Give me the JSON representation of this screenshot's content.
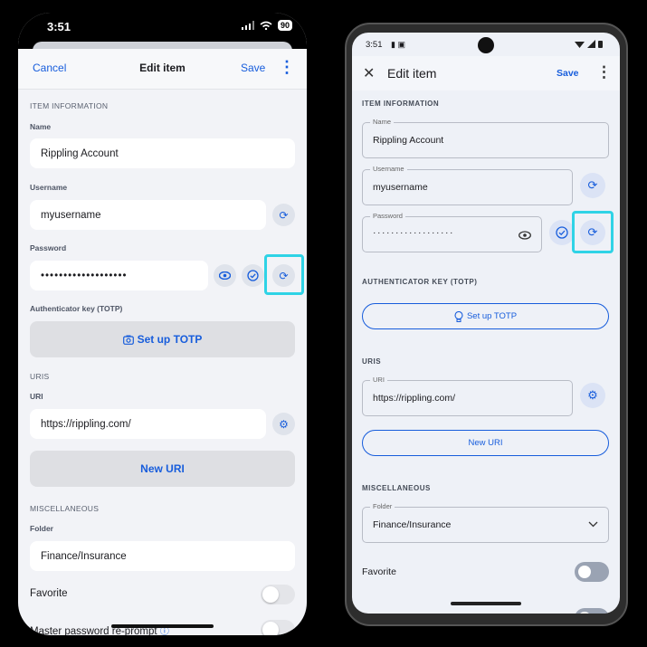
{
  "ios": {
    "status": {
      "time": "3:51",
      "battery": "90"
    },
    "nav": {
      "cancel": "Cancel",
      "title": "Edit item",
      "save": "Save"
    },
    "item_info_header": "ITEM INFORMATION",
    "name_label": "Name",
    "name_value": "Rippling Account",
    "username_label": "Username",
    "username_value": "myusername",
    "password_label": "Password",
    "password_value": "•••••••••••••••••••",
    "totp_label": "Authenticator key (TOTP)",
    "totp_button": "Set up TOTP",
    "uris_header": "URIS",
    "uri_label": "URI",
    "uri_value": "https://rippling.com/",
    "new_uri_button": "New URI",
    "misc_header": "MISCELLANEOUS",
    "folder_label": "Folder",
    "folder_value": "Finance/Insurance",
    "favorite_label": "Favorite",
    "reprompt_label": "Master password re-prompt",
    "accent_color": "#175ddc",
    "highlight_color": "#2fd3e6"
  },
  "android": {
    "status": {
      "time": "3:51"
    },
    "header": {
      "title": "Edit item",
      "save": "Save"
    },
    "item_info_header": "ITEM INFORMATION",
    "name_label": "Name",
    "name_value": "Rippling Account",
    "username_label": "Username",
    "username_value": "myusername",
    "password_label": "Password",
    "password_value": "··················",
    "auth_header": "AUTHENTICATOR KEY (TOTP)",
    "totp_button": "Set up TOTP",
    "uris_header": "URIS",
    "uri_label": "URI",
    "uri_value": "https://rippling.com/",
    "new_uri_button": "New URI",
    "misc_header": "MISCELLANEOUS",
    "folder_label": "Folder",
    "folder_value": "Finance/Insurance",
    "favorite_label": "Favorite"
  }
}
